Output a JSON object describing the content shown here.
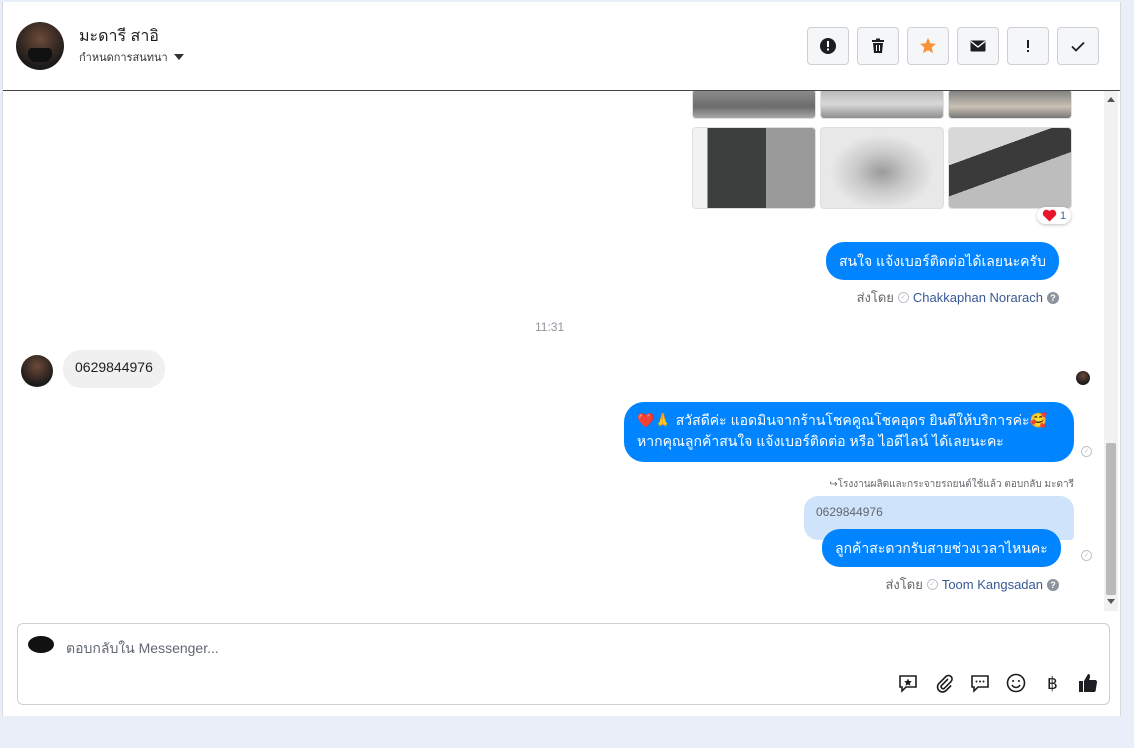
{
  "header": {
    "contact_name": "มะดารี สาอิ",
    "conversation_menu": "กำหนดการสนทนา"
  },
  "header_actions": [
    "alert-icon",
    "trash-icon",
    "star-icon",
    "mail-icon",
    "exclamation-icon",
    "check-icon"
  ],
  "messages": {
    "reaction_count": "1",
    "msg1": "สนใจ แจ้งเบอร์ติดต่อได้เลยนะครับ",
    "sent_by_label": "ส่งโดย",
    "msg1_sender": "Chakkaphan Norarach",
    "time_divider": "11:31",
    "incoming_phone": "0629844976",
    "msg2_line1": "❤️🙏 สวัสดีค่ะ แอดมินจากร้านโชคคูณโชคอุดร ยินดีให้บริการค่ะ🥰",
    "msg2_line2": "หากคุณลูกค้าสนใจ แจ้งเบอร์ติดต่อ หรือ ไอดีไลน์ ได้เลยนะคะ",
    "reply_context": "↪โรงงานผลิตและกระจายรถยนต์ใช้แล้ว ตอบกลับ มะดารี",
    "quoted_text": "0629844976",
    "msg3": "ลูกค้าสะดวกรับสายช่วงเวลาไหนคะ",
    "msg3_sender": "Toom Kangsadan"
  },
  "composer": {
    "placeholder": "ตอบกลับใน Messenger..."
  },
  "colors": {
    "messenger_blue": "#0084ff",
    "quote_blue": "#cfe3fb",
    "star_orange": "#f7923a"
  }
}
